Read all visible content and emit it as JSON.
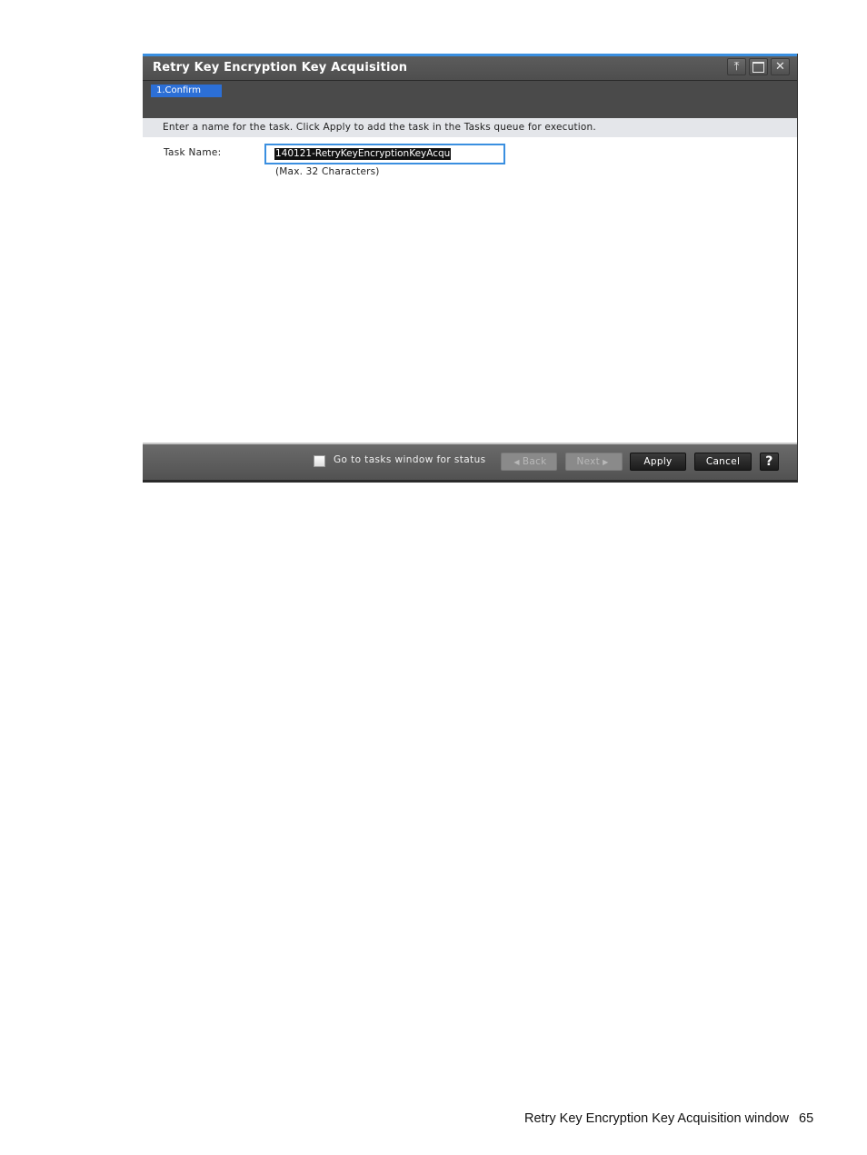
{
  "window": {
    "title": "Retry Key Encryption Key Acquisition",
    "controls": [
      "pin-icon",
      "maximize-icon",
      "close-icon"
    ],
    "steps": [
      {
        "label": "1.Confirm",
        "active": true
      }
    ],
    "instruction": "Enter a name for the task. Click Apply to add the task in the Tasks queue for execution.",
    "task_name": {
      "label": "Task Name:",
      "value": "140121-RetryKeyEncryptionKeyAcqu",
      "hint": "(Max. 32 Characters)"
    },
    "footer": {
      "checkbox_label": "Go to tasks window for status",
      "checkbox_checked": false,
      "back_label": "Back",
      "next_label": "Next",
      "apply_label": "Apply",
      "cancel_label": "Cancel",
      "help_label": "?"
    }
  },
  "page": {
    "footer_text": "Retry Key Encryption Key Acquisition window",
    "page_number": "65"
  },
  "colors": {
    "accent": "#3a8fe0",
    "step_active": "#2c6fd6",
    "titlebar": "#555555"
  }
}
